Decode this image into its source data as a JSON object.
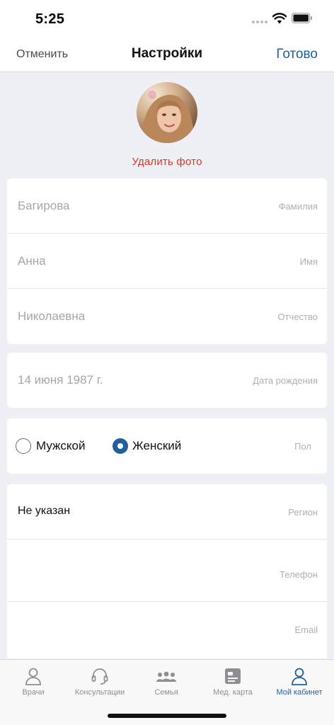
{
  "status_bar": {
    "time": "5:25"
  },
  "nav": {
    "cancel": "Отменить",
    "title": "Настройки",
    "done": "Готово"
  },
  "profile": {
    "delete_photo": "Удалить фото"
  },
  "name_fields": [
    {
      "value": "Багирова",
      "label": "Фамилия"
    },
    {
      "value": "Анна",
      "label": "Имя"
    },
    {
      "value": "Николаевна",
      "label": "Отчество"
    }
  ],
  "birth": {
    "value": "14 июня 1987 г.",
    "label": "Дата рождения"
  },
  "gender": {
    "male": "Мужской",
    "female": "Женский",
    "label": "Пол",
    "selected": "female"
  },
  "contacts": [
    {
      "value": "Не указан",
      "label": "Регион"
    },
    {
      "value": "",
      "label": "Телефон"
    },
    {
      "value": "",
      "label": "Email"
    }
  ],
  "tabs": [
    {
      "label": "Врачи",
      "icon": "doctor-icon"
    },
    {
      "label": "Консультации",
      "icon": "headset-icon"
    },
    {
      "label": "Семья",
      "icon": "family-icon"
    },
    {
      "label": "Мед. карта",
      "icon": "med-card-icon"
    },
    {
      "label": "Мой кабинет",
      "icon": "profile-icon",
      "active": true
    }
  ],
  "colors": {
    "accent": "#1f5f9e",
    "danger": "#e3321f",
    "background": "#eef0f6"
  }
}
